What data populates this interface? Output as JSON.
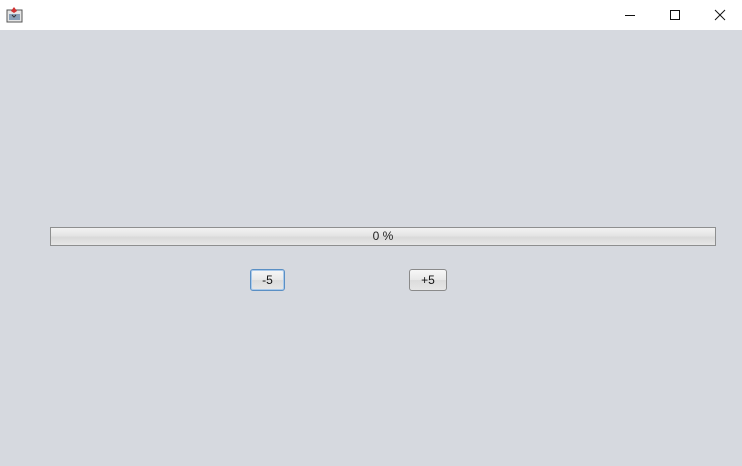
{
  "window": {
    "icon": "java-app-icon",
    "controls": {
      "minimize_icon": "minimize-icon",
      "maximize_icon": "maximize-icon",
      "close_icon": "close-icon"
    }
  },
  "progress": {
    "value_percent": 0,
    "label": "0 %"
  },
  "buttons": {
    "decrement_label": "-5",
    "increment_label": "+5"
  },
  "colors": {
    "background": "#d6d9df",
    "titlebar": "#ffffff",
    "focus_border": "#5a8fc4"
  }
}
